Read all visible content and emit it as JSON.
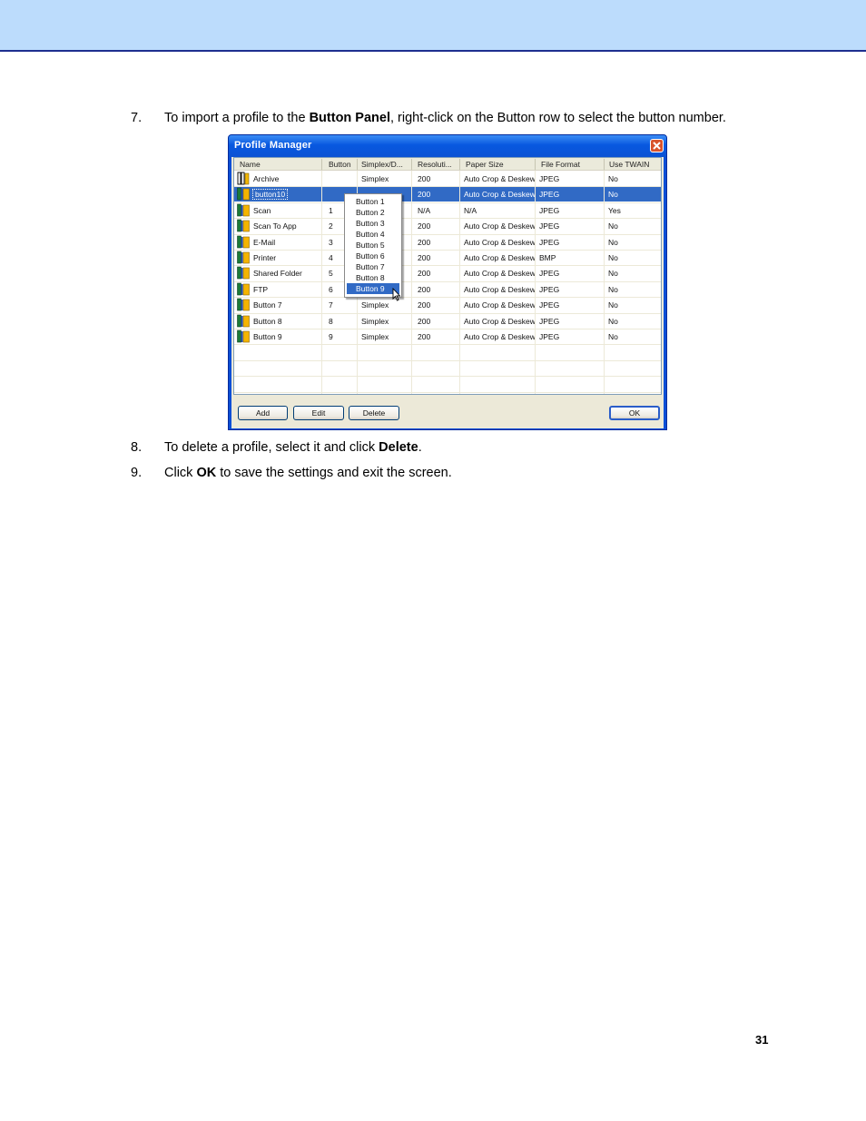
{
  "steps": [
    {
      "num": "7.",
      "pre": "To import a profile to the ",
      "bold": "Button Panel",
      "post": ", right-click on the Button row to select the button number."
    },
    {
      "num": "8.",
      "pre": "To delete a profile, select it and click ",
      "bold": "Delete",
      "post": "."
    },
    {
      "num": "9.",
      "pre": "Click ",
      "bold": "OK",
      "post": " to save the settings and exit the screen."
    }
  ],
  "dialog": {
    "title": "Profile Manager",
    "columns": [
      "Name",
      "Button",
      "Simplex/D...",
      "Resoluti...",
      "Paper Size",
      "File Format",
      "Use TWAIN"
    ],
    "rows": [
      {
        "name": "Archive",
        "button": "",
        "simplex": "Simplex",
        "res": "200",
        "paper": "Auto Crop & Deskew",
        "format": "JPEG",
        "twain": "No"
      },
      {
        "name": "button10",
        "button": "",
        "simplex": "",
        "res": "200",
        "paper": "Auto Crop & Deskew",
        "format": "JPEG",
        "twain": "No"
      },
      {
        "name": "Scan",
        "button": "1",
        "simplex": "",
        "res": "N/A",
        "paper": "N/A",
        "format": "JPEG",
        "twain": "Yes"
      },
      {
        "name": "Scan To App",
        "button": "2",
        "simplex": "",
        "res": "200",
        "paper": "Auto Crop & Deskew",
        "format": "JPEG",
        "twain": "No"
      },
      {
        "name": "E-Mail",
        "button": "3",
        "simplex": "",
        "res": "200",
        "paper": "Auto Crop & Deskew",
        "format": "JPEG",
        "twain": "No"
      },
      {
        "name": "Printer",
        "button": "4",
        "simplex": "",
        "res": "200",
        "paper": "Auto Crop & Deskew",
        "format": "BMP",
        "twain": "No"
      },
      {
        "name": "Shared Folder",
        "button": "5",
        "simplex": "",
        "res": "200",
        "paper": "Auto Crop & Deskew",
        "format": "JPEG",
        "twain": "No"
      },
      {
        "name": "FTP",
        "button": "6",
        "simplex": "",
        "res": "200",
        "paper": "Auto Crop & Deskew",
        "format": "JPEG",
        "twain": "No"
      },
      {
        "name": "Button 7",
        "button": "7",
        "simplex": "Simplex",
        "res": "200",
        "paper": "Auto Crop & Deskew",
        "format": "JPEG",
        "twain": "No"
      },
      {
        "name": "Button 8",
        "button": "8",
        "simplex": "Simplex",
        "res": "200",
        "paper": "Auto Crop & Deskew",
        "format": "JPEG",
        "twain": "No"
      },
      {
        "name": "Button 9",
        "button": "9",
        "simplex": "Simplex",
        "res": "200",
        "paper": "Auto Crop & Deskew",
        "format": "JPEG",
        "twain": "No"
      }
    ],
    "selected_row": 1,
    "context_menu": [
      "Button 1",
      "Button 2",
      "Button 3",
      "Button 4",
      "Button 5",
      "Button 6",
      "Button 7",
      "Button 8",
      "Button 9"
    ],
    "context_menu_highlight": 8,
    "buttons": {
      "add": "Add",
      "edit": "Edit",
      "delete": "Delete",
      "ok": "OK"
    }
  },
  "page_number": "31",
  "colors": {
    "header_band": "#bcdcfc",
    "selection": "#316ac5",
    "title_bar": "#0a52d4"
  }
}
